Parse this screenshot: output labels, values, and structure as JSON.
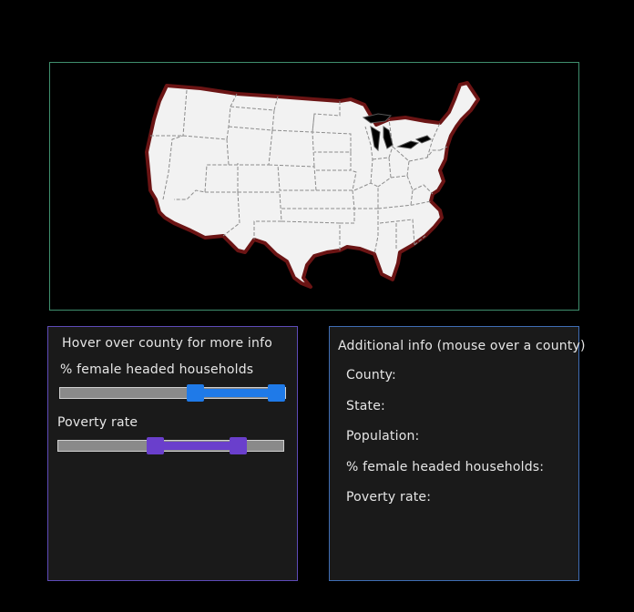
{
  "map": {
    "border_color": "#3f8f6e",
    "land_color": "#f2f2f2",
    "outline_color": "#6b1414"
  },
  "filters": {
    "title": "Hover over county for more info",
    "female_households": {
      "label": "% female headed households",
      "range_color": "#1f7ae8",
      "low_fraction": 0.6,
      "high_fraction": 0.96
    },
    "poverty": {
      "label": "Poverty rate",
      "range_color": "#6a3fcc",
      "low_fraction": 0.43,
      "high_fraction": 0.8
    }
  },
  "info": {
    "title": "Additional info (mouse over a county)",
    "county_label": "County:",
    "state_label": "State:",
    "population_label": "Population:",
    "female_label": "% female headed households:",
    "poverty_label": "Poverty rate:"
  }
}
